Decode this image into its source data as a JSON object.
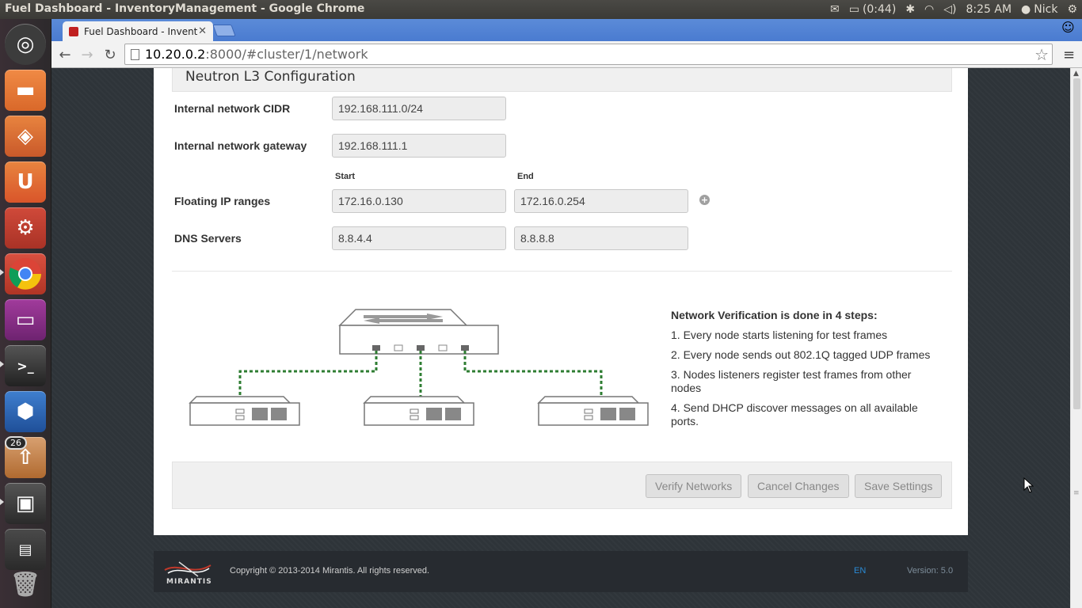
{
  "os_panel": {
    "window_title": "Fuel Dashboard - InventoryManagement - Google Chrome",
    "battery": "(0:44)",
    "clock": "8:25 AM",
    "user": "Nick"
  },
  "launcher": {
    "items": [
      {
        "name": "ubuntu-dash",
        "color": "#3c3c3c"
      },
      {
        "name": "files",
        "color": "#d9682a"
      },
      {
        "name": "software-center",
        "color": "#d9682a"
      },
      {
        "name": "ubuntu-one",
        "color": "#d9682a"
      },
      {
        "name": "system-settings",
        "color": "#c0392b"
      },
      {
        "name": "chrome",
        "color": "#d04030"
      },
      {
        "name": "remote-desktop",
        "color": "#8e2f8a"
      },
      {
        "name": "terminal",
        "color": "#2b2b2b"
      },
      {
        "name": "virtualbox",
        "color": "#2a62a8"
      },
      {
        "name": "update-manager",
        "color": "#c07a40"
      },
      {
        "name": "system-monitor",
        "color": "#3a3a3a"
      },
      {
        "name": "workspace-switcher",
        "color": "#3a3a3a"
      },
      {
        "name": "trash",
        "color": "#3a3a3a"
      }
    ],
    "update_badge": "26"
  },
  "browser": {
    "tab_title": "Fuel Dashboard - Inventor",
    "url_host": "10.20.0.2",
    "url_rest": ":8000/#cluster/1/network"
  },
  "network": {
    "section_title": "Neutron L3 Configuration",
    "internal_cidr_label": "Internal network CIDR",
    "internal_cidr_value": "192.168.111.0/24",
    "internal_gateway_label": "Internal network gateway",
    "internal_gateway_value": "192.168.111.1",
    "start_header": "Start",
    "end_header": "End",
    "floating_label": "Floating IP ranges",
    "floating_start": "172.16.0.130",
    "floating_end": "172.16.0.254",
    "dns_label": "DNS Servers",
    "dns_1": "8.8.4.4",
    "dns_2": "8.8.8.8"
  },
  "verification": {
    "heading": "Network Verification is done in 4 steps:",
    "steps": [
      "1. Every node starts listening for test frames",
      "2. Every node sends out 802.1Q tagged UDP frames",
      "3. Nodes listeners register test frames from other nodes",
      "4. Send DHCP discover messages on all available ports."
    ]
  },
  "actions": {
    "verify": "Verify Networks",
    "cancel": "Cancel Changes",
    "save": "Save Settings"
  },
  "footer": {
    "logo_text": "MIRANTIS",
    "copyright": "Copyright © 2013-2014 Mirantis. All rights reserved.",
    "language": "EN",
    "version": "Version: 5.0"
  }
}
